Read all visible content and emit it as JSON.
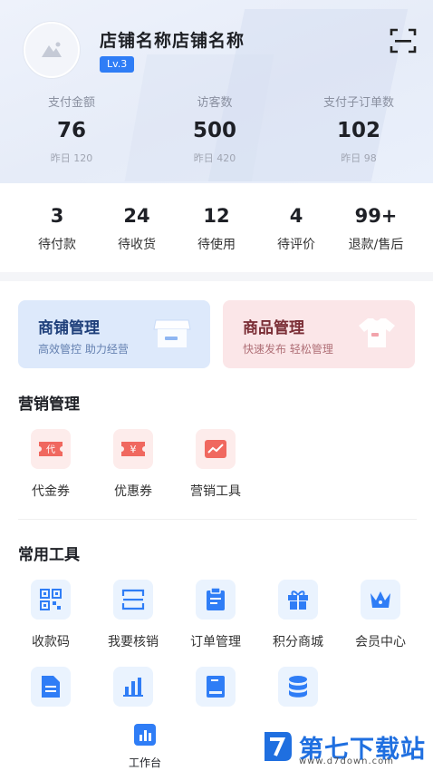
{
  "header": {
    "store_name": "店铺名称店铺名称",
    "level": "Lv.3",
    "stats": [
      {
        "label": "支付金额",
        "value": "76",
        "prev": "昨日 120"
      },
      {
        "label": "访客数",
        "value": "500",
        "prev": "昨日 420"
      },
      {
        "label": "支付子订单数",
        "value": "102",
        "prev": "昨日 98"
      }
    ]
  },
  "orders": [
    {
      "count": "3",
      "label": "待付款"
    },
    {
      "count": "24",
      "label": "待收货"
    },
    {
      "count": "12",
      "label": "待使用"
    },
    {
      "count": "4",
      "label": "待评价"
    },
    {
      "count": "99+",
      "label": "退款/售后"
    }
  ],
  "cards": {
    "store": {
      "title": "商铺管理",
      "subtitle": "高效管控 助力经营"
    },
    "goods": {
      "title": "商品管理",
      "subtitle": "快速发布 轻松管理"
    }
  },
  "marketing": {
    "title": "营销管理",
    "items": [
      {
        "label": "代金券",
        "icon": "voucher-icon",
        "glyph": "代"
      },
      {
        "label": "优惠券",
        "icon": "coupon-icon",
        "glyph": "¥"
      },
      {
        "label": "营销工具",
        "icon": "marketing-chart-icon",
        "glyph": ""
      }
    ]
  },
  "tools": {
    "title": "常用工具",
    "items": [
      {
        "label": "收款码",
        "icon": "qr-code-icon"
      },
      {
        "label": "我要核销",
        "icon": "scan-verify-icon"
      },
      {
        "label": "订单管理",
        "icon": "clipboard-icon"
      },
      {
        "label": "积分商城",
        "icon": "gift-icon"
      },
      {
        "label": "会员中心",
        "icon": "crown-icon"
      }
    ],
    "row2_icons": [
      "document-icon",
      "bar-chart-icon",
      "book-icon",
      "database-icon"
    ]
  },
  "tabbar": {
    "label": "工作台",
    "icon": "workbench-icon"
  },
  "watermark": {
    "text": "第七下载站",
    "url": "www.d7down.com"
  },
  "colors": {
    "accent": "#2f7df6",
    "red": "#f0685f",
    "card_blue": "#dde9fb",
    "card_red": "#fbe6e8"
  }
}
